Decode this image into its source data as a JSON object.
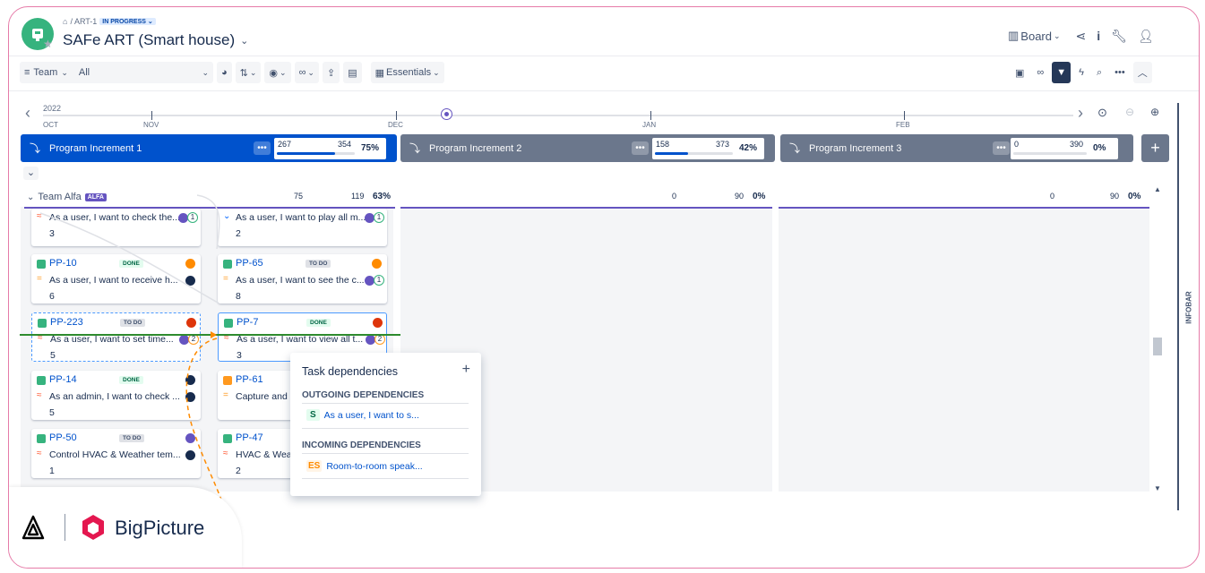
{
  "breadcrumb": {
    "path": "/ ART-1",
    "status": "IN PROGRESS"
  },
  "page": {
    "title": "SAFe ART (Smart house)"
  },
  "header": {
    "board_label": "Board"
  },
  "toolbar": {
    "team_label": "Team",
    "filter_value": "All",
    "essentials_label": "Essentials"
  },
  "timeline": {
    "year": "2022",
    "months": [
      "OCT",
      "NOV",
      "DEC",
      "JAN",
      "FEB"
    ]
  },
  "increments": [
    {
      "name": "Program Increment 1",
      "done": "267",
      "total": "354",
      "percent": "75%",
      "progress": 0.75,
      "color": "#0052cc"
    },
    {
      "name": "Program Increment 2",
      "done": "158",
      "total": "373",
      "percent": "42%",
      "progress": 0.42,
      "color": "#6b778c"
    },
    {
      "name": "Program Increment 3",
      "done": "0",
      "total": "390",
      "percent": "0%",
      "progress": 0,
      "color": "#6b778c"
    }
  ],
  "team": {
    "name": "Team Alfa",
    "badge": "ALFA",
    "done": "75",
    "total": "119",
    "percent": "63%",
    "col2": {
      "done": "0",
      "total": "90",
      "percent": "0%"
    },
    "col3": {
      "done": "0",
      "total": "90",
      "percent": "0%"
    }
  },
  "cards_col1": [
    {
      "key": "",
      "status": "",
      "summary": "As a user, I want to check the...",
      "points": "3",
      "dep": "1"
    },
    {
      "key": "PP-10",
      "status": "DONE",
      "summary": "As a user, I want to receive h...",
      "points": "6",
      "dep": ""
    },
    {
      "key": "PP-223",
      "status": "TO DO",
      "summary": "As a user, I want to set time...",
      "points": "5",
      "dep": "2"
    },
    {
      "key": "PP-14",
      "status": "DONE",
      "summary": "As an admin, I want to check ...",
      "points": "5",
      "dep": ""
    },
    {
      "key": "PP-50",
      "status": "TO DO",
      "summary": "Control HVAC & Weather tem...",
      "points": "1",
      "dep": ""
    }
  ],
  "cards_col2": [
    {
      "key": "",
      "status": "",
      "summary": "As a user, I want to play all m...",
      "points": "2",
      "dep": "1"
    },
    {
      "key": "PP-65",
      "status": "TO DO",
      "summary": "As a user, I want to see the c...",
      "points": "8",
      "dep": "1"
    },
    {
      "key": "PP-7",
      "status": "DONE",
      "summary": "As a user, I want to view all t...",
      "points": "3",
      "dep": "2"
    },
    {
      "key": "PP-61",
      "status": "",
      "summary": "Capture and",
      "points": "",
      "dep": ""
    },
    {
      "key": "PP-47",
      "status": "",
      "summary": "HVAC & Wea",
      "points": "2",
      "dep": ""
    }
  ],
  "popup": {
    "title": "Task dependencies",
    "outgoing_label": "OUTGOING DEPENDENCIES",
    "outgoing": [
      {
        "tag": "S",
        "text": "As a user, I want to s..."
      }
    ],
    "incoming_label": "INCOMING DEPENDENCIES",
    "incoming": [
      {
        "tag": "ES",
        "text": "Room-to-room speak..."
      }
    ]
  },
  "infobar": {
    "label": "INFOBAR"
  },
  "brand": {
    "name": "BigPicture",
    "accent": "#e4174f"
  }
}
